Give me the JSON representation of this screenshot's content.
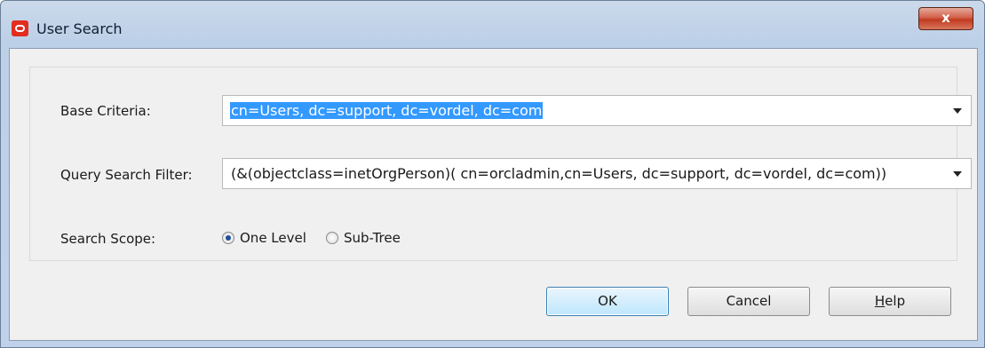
{
  "window": {
    "title": "User Search",
    "close_label": "x"
  },
  "form": {
    "base_criteria_label": "Base Criteria:",
    "base_criteria_value": "cn=Users, dc=support, dc=vordel, dc=com",
    "query_filter_label": "Query Search Filter:",
    "query_filter_value": "(&(objectclass=inetOrgPerson)( cn=orcladmin,cn=Users, dc=support, dc=vordel, dc=com))",
    "search_scope_label": "Search Scope:",
    "scope_options": [
      {
        "label": "One Level",
        "selected": true
      },
      {
        "label": "Sub-Tree",
        "selected": false
      }
    ]
  },
  "buttons": {
    "ok": "OK",
    "cancel": "Cancel",
    "help_mnemonic": "H",
    "help_rest": "elp"
  },
  "colors": {
    "selection": "#3399ff",
    "close_button": "#c23a1f",
    "app_icon": "#e22d1f"
  }
}
